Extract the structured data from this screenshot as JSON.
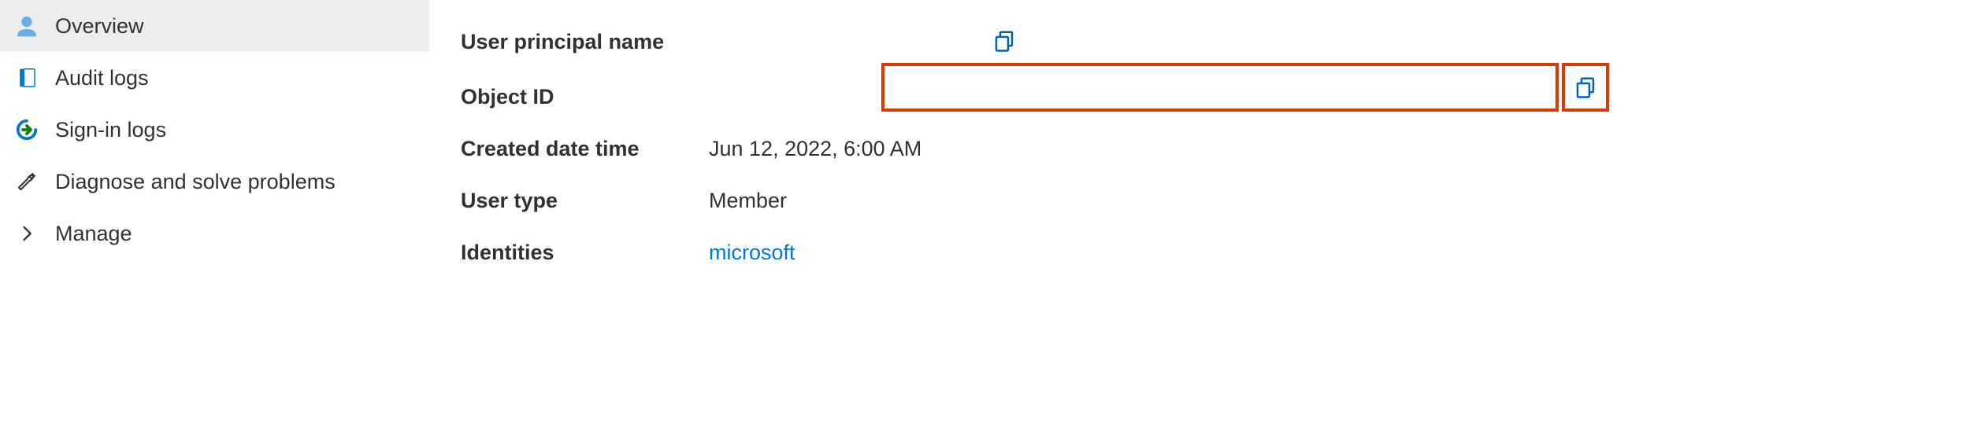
{
  "sidebar": {
    "items": [
      {
        "label": "Overview"
      },
      {
        "label": "Audit logs"
      },
      {
        "label": "Sign-in logs"
      },
      {
        "label": "Diagnose and solve problems"
      },
      {
        "label": "Manage"
      }
    ]
  },
  "properties": {
    "upn_label": "User principal name",
    "upn_value": "",
    "object_id_label": "Object ID",
    "object_id_value": "",
    "created_label": "Created date time",
    "created_value": "Jun 12, 2022, 6:00 AM",
    "user_type_label": "User type",
    "user_type_value": "Member",
    "identities_label": "Identities",
    "identities_value": "microsoft"
  },
  "colors": {
    "highlight": "#d83b01",
    "link": "#0078d4",
    "icon_blue": "#0078d4",
    "icon_teal": "#69afe5",
    "icon_green": "#107c10",
    "active_bg": "#ededed"
  }
}
